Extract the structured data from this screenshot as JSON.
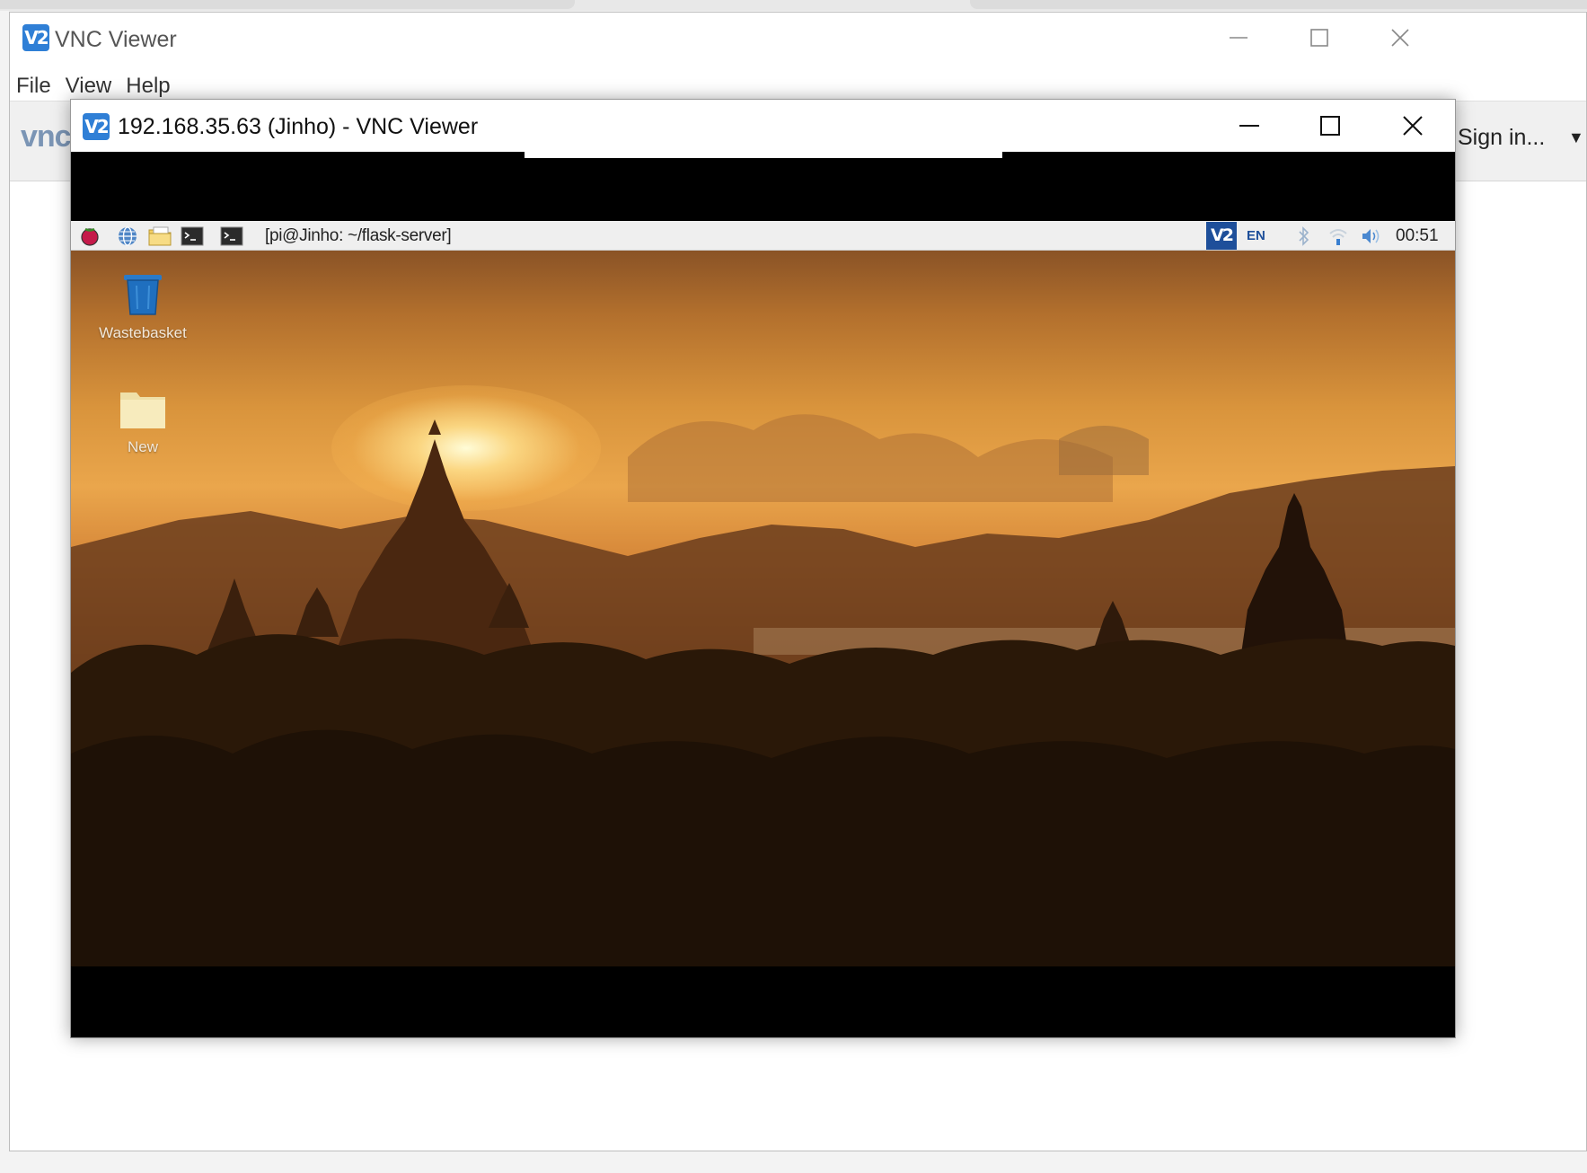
{
  "main_window": {
    "title": "VNC Viewer",
    "logo_text": "V2",
    "menu": [
      "File",
      "View",
      "Help"
    ],
    "wordmark": "vnc",
    "signin_label": "Sign in..."
  },
  "session_window": {
    "title": "192.168.35.63 (Jinho) - VNC Viewer",
    "logo_text": "V2"
  },
  "remote_desktop": {
    "taskbar": {
      "task_label": "[pi@Jinho: ~/flask-server]",
      "tray_vnc": "V2",
      "tray_lang": "EN",
      "clock": "00:51"
    },
    "icons": [
      {
        "label": "Wastebasket",
        "icon": "wastebasket-icon"
      },
      {
        "label": "New",
        "icon": "folder-icon"
      }
    ]
  },
  "colors": {
    "vnc_blue": "#2f7fd6",
    "tray_blue": "#1e4f9a"
  }
}
